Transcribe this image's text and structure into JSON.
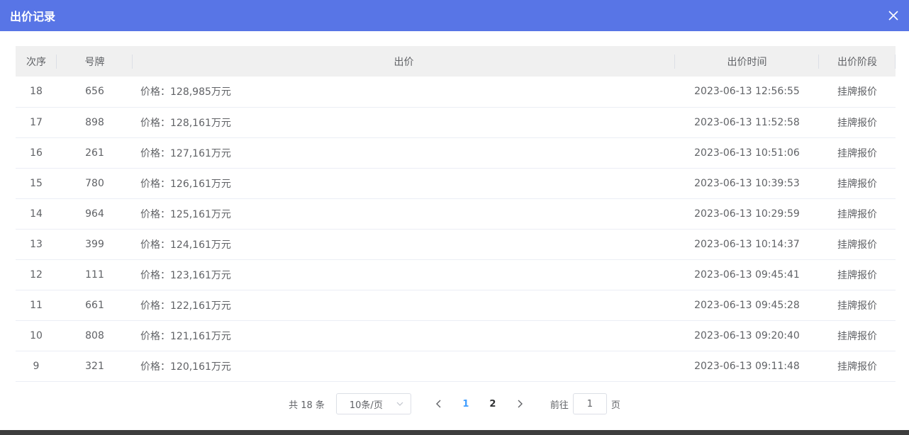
{
  "dialog": {
    "title": "出价记录",
    "close_icon": "close-icon"
  },
  "table": {
    "headers": {
      "index": "次序",
      "plate": "号牌",
      "price": "出价",
      "time": "出价时间",
      "stage": "出价阶段"
    },
    "rows": [
      {
        "index": "18",
        "plate": "656",
        "price": "价格：128,985万元",
        "time": "2023-06-13 12:56:55",
        "stage": "挂牌报价"
      },
      {
        "index": "17",
        "plate": "898",
        "price": "价格：128,161万元",
        "time": "2023-06-13 11:52:58",
        "stage": "挂牌报价"
      },
      {
        "index": "16",
        "plate": "261",
        "price": "价格：127,161万元",
        "time": "2023-06-13 10:51:06",
        "stage": "挂牌报价"
      },
      {
        "index": "15",
        "plate": "780",
        "price": "价格：126,161万元",
        "time": "2023-06-13 10:39:53",
        "stage": "挂牌报价"
      },
      {
        "index": "14",
        "plate": "964",
        "price": "价格：125,161万元",
        "time": "2023-06-13 10:29:59",
        "stage": "挂牌报价"
      },
      {
        "index": "13",
        "plate": "399",
        "price": "价格：124,161万元",
        "time": "2023-06-13 10:14:37",
        "stage": "挂牌报价"
      },
      {
        "index": "12",
        "plate": "111",
        "price": "价格：123,161万元",
        "time": "2023-06-13 09:45:41",
        "stage": "挂牌报价"
      },
      {
        "index": "11",
        "plate": "661",
        "price": "价格：122,161万元",
        "time": "2023-06-13 09:45:28",
        "stage": "挂牌报价"
      },
      {
        "index": "10",
        "plate": "808",
        "price": "价格：121,161万元",
        "time": "2023-06-13 09:20:40",
        "stage": "挂牌报价"
      },
      {
        "index": "9",
        "plate": "321",
        "price": "价格：120,161万元",
        "time": "2023-06-13 09:11:48",
        "stage": "挂牌报价"
      }
    ]
  },
  "pagination": {
    "total_text": "共 18 条",
    "page_size": "10条/页",
    "pages": [
      "1",
      "2"
    ],
    "current_page": "1",
    "goto_prefix": "前往",
    "goto_value": "1",
    "goto_suffix": "页"
  },
  "colors": {
    "title_bar": "#5875e6",
    "active_page": "#409eff"
  }
}
